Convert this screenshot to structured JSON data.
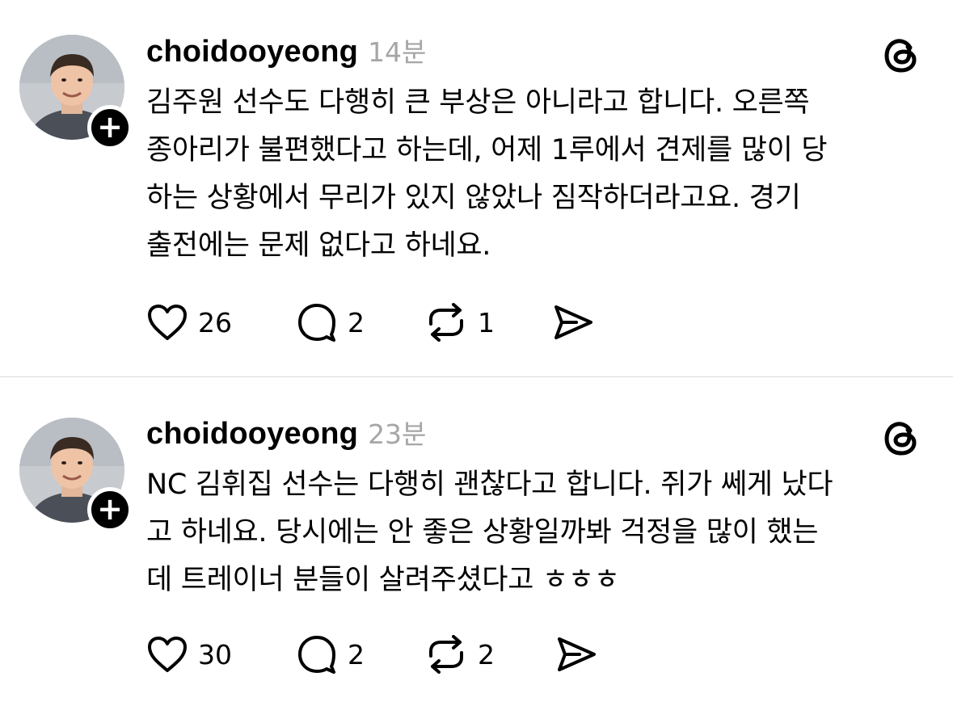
{
  "posts": [
    {
      "username": "choidooyeong",
      "time": "14분",
      "text": "김주원 선수도 다행히 큰 부상은 아니라고 합니다. 오른쪽\n종아리가 불편했다고 하는데, 어제 1루에서 견제를 많이 당\n하는 상황에서 무리가 있지 않았나 짐작하더라고요. 경기\n출전에는 문제 없다고 하네요.",
      "likes": "26",
      "replies": "2",
      "reposts": "1"
    },
    {
      "username": "choidooyeong",
      "time": "23분",
      "text": "NC 김휘집 선수는 다행히 괜찮다고 합니다. 쥐가 쎄게 났다\n고 하네요. 당시에는 안 좋은 상황일까봐 걱정을 많이 했는\n데 트레이너 분들이 살려주셨다고 ㅎㅎㅎ",
      "likes": "30",
      "replies": "2",
      "reposts": "2"
    }
  ],
  "icons": {
    "follow": "plus-icon",
    "app": "threads-icon",
    "like": "heart-icon",
    "reply": "comment-icon",
    "repost": "repost-icon",
    "share": "send-icon"
  },
  "colors": {
    "text": "#000000",
    "muted": "#a6a6a6",
    "divider": "#d9d9d9",
    "badge": "#000000"
  }
}
